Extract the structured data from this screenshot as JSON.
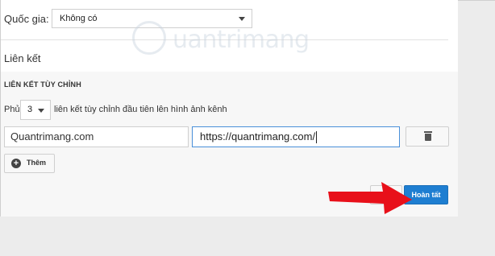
{
  "country": {
    "label": "Quốc gia:",
    "selected": "Không có"
  },
  "links": {
    "heading": "Liên kết",
    "custom_heading": "LIÊN KẾT TÙY CHỈNH",
    "cover_label": "Phủ",
    "cover_count": "3",
    "cover_desc": "liên kết tùy chỉnh đầu tiên lên hình ảnh kênh",
    "items": [
      {
        "title": "Quantrimang.com",
        "url": "https://quantrimang.com/"
      }
    ],
    "add_label": "Thêm"
  },
  "actions": {
    "done_label": "Hoàn tất"
  },
  "watermark": {
    "text": "uantrimang"
  },
  "colors": {
    "accent": "#1e7ed1",
    "arrow": "#e8101a"
  }
}
